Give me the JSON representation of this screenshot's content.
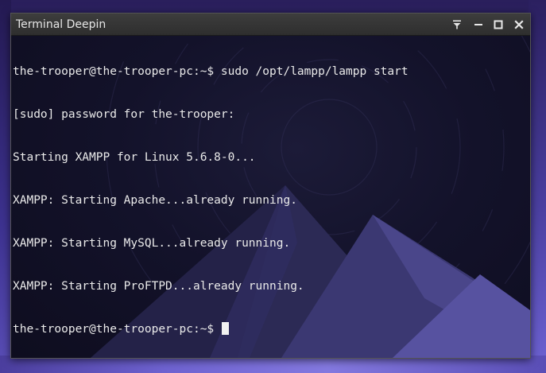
{
  "window": {
    "title": "Terminal Deepin"
  },
  "titlebar_buttons": [
    {
      "name": "pin-icon"
    },
    {
      "name": "minimize-icon"
    },
    {
      "name": "maximize-icon"
    },
    {
      "name": "close-icon"
    }
  ],
  "terminal": {
    "lines": [
      "the-trooper@the-trooper-pc:~$ sudo /opt/lampp/lampp start",
      "[sudo] password for the-trooper:",
      "Starting XAMPP for Linux 5.6.8-0...",
      "XAMPP: Starting Apache...already running.",
      "XAMPP: Starting MySQL...already running.",
      "XAMPP: Starting ProFTPD...already running.",
      "the-trooper@the-trooper-pc:~$ "
    ]
  },
  "colors": {
    "terminal_text": "#eaeaea",
    "terminal_background": "#13122a",
    "titlebar": "#333333"
  }
}
